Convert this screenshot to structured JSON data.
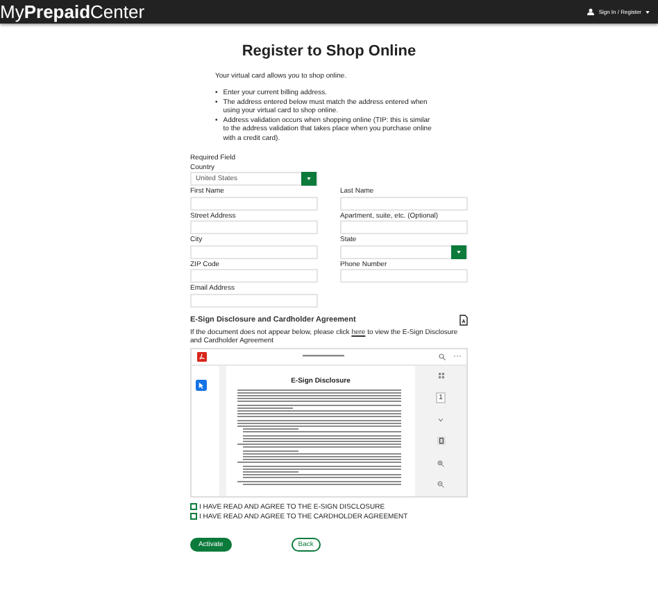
{
  "header": {
    "logo": "My**Prepaid**Center",
    "account_menu": "Sign In / Register"
  },
  "page": {
    "title": "Register to Shop Online",
    "intro": "Your virtual card allows you to shop online.",
    "bullets": [
      {
        "marker": "•",
        "text": "Enter your current billing address."
      },
      {
        "marker": "•",
        "text": "The address entered below must match the address entered when using your virtual card to shop online."
      },
      {
        "marker": "•",
        "text": "Address validation occurs when shopping online (TIP: this is similar to the address validation that takes place when you purchase online with a credit card)."
      }
    ]
  },
  "form": {
    "required_note": "Required Field",
    "fields": [
      {
        "label": "Country",
        "kind": "select",
        "value": "United States"
      },
      {
        "label": "First Name",
        "kind": "input"
      },
      {
        "label": "Last Name",
        "kind": "input"
      },
      {
        "label": "Street Address",
        "kind": "input"
      },
      {
        "label": "Apartment, suite, etc. (Optional)",
        "kind": "input"
      },
      {
        "label": "City",
        "kind": "input"
      },
      {
        "label": "State",
        "kind": "select"
      },
      {
        "label": "ZIP Code",
        "kind": "input"
      },
      {
        "label": "Phone Number",
        "kind": "input"
      },
      {
        "label": "Email Address",
        "kind": "input"
      }
    ]
  },
  "agreement": {
    "title": "E-Sign Disclosure and Cardholder Agreement",
    "note_before": "If the document does not appear below, please click ",
    "link": "here",
    "note_after": " to view the E-Sign Disclosure and Cardholder Agreement",
    "viewer": {
      "page_heading": "E-Sign Disclosure",
      "page_number": "1"
    }
  },
  "checkboxes": [
    {
      "label": "I HAVE READ AND AGREE TO THE E-SIGN DISCLOSURE",
      "checked": false
    },
    {
      "label": "I HAVE READ AND AGREE TO THE CARDHOLDER AGREEMENT",
      "checked": false
    }
  ],
  "buttons": [
    {
      "label": "Activate",
      "kind": "primary"
    },
    {
      "label": "Back",
      "kind": "secondary"
    }
  ]
}
